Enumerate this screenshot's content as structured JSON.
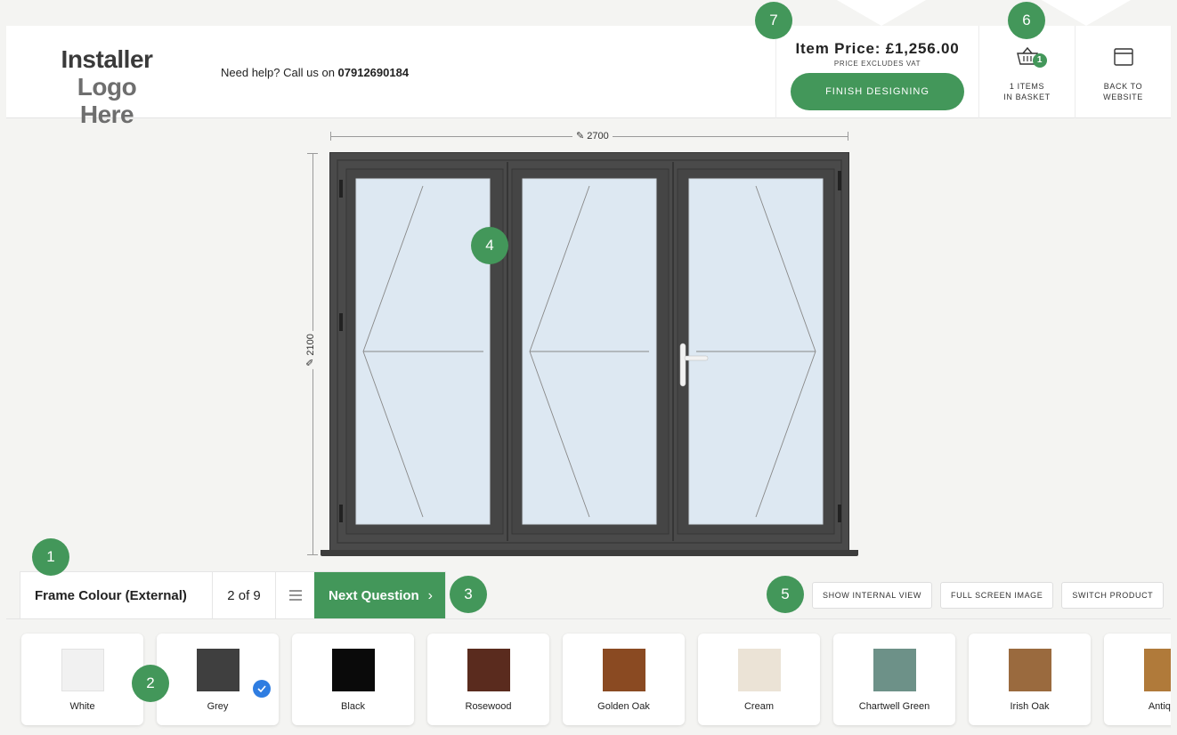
{
  "header": {
    "logo_line1": "Installer",
    "logo_line2": "Logo Here",
    "help_text": "Need help? Call us on ",
    "help_phone": "07912690184",
    "price_label": "Item Price: £1,256.00",
    "vat_note": "PRICE EXCLUDES VAT",
    "finish_label": "FINISH DESIGNING",
    "basket_count": "1",
    "basket_line1": "1 ITEMS",
    "basket_line2": "IN BASKET",
    "back_line1": "BACK TO",
    "back_line2": "WEBSITE"
  },
  "badges": [
    "1",
    "2",
    "3",
    "4",
    "5",
    "6",
    "7"
  ],
  "dimensions": {
    "width": "2700",
    "height": "2100"
  },
  "question": {
    "title": "Frame Colour (External)",
    "step": "2 of 9",
    "next_label": "Next Question"
  },
  "view_buttons": {
    "internal": "SHOW INTERNAL VIEW",
    "fullscreen": "FULL SCREEN IMAGE",
    "switch": "SWITCH PRODUCT"
  },
  "colours": [
    {
      "name": "White",
      "color": "#f1f1f1"
    },
    {
      "name": "Grey",
      "color": "#3f3f3f",
      "selected": true
    },
    {
      "name": "Black",
      "color": "#0a0a0a"
    },
    {
      "name": "Rosewood",
      "color": "#5a2b1e"
    },
    {
      "name": "Golden Oak",
      "color": "#8a4a22"
    },
    {
      "name": "Cream",
      "color": "#ebe3d6"
    },
    {
      "name": "Chartwell Green",
      "color": "#6d9188"
    },
    {
      "name": "Irish Oak",
      "color": "#9a6a3e"
    },
    {
      "name": "Antique",
      "color": "#b07a3a"
    }
  ],
  "theme": {
    "accent": "#43975a",
    "check": "#2f7de1"
  }
}
